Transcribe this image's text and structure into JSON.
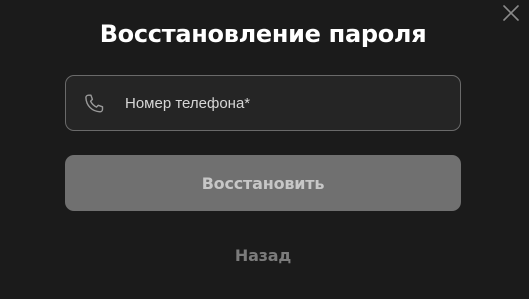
{
  "modal": {
    "title": "Восстановление пароля",
    "close_icon": "close-icon"
  },
  "phone_field": {
    "icon": "phone-icon",
    "placeholder": "Номер телефона*",
    "value": ""
  },
  "submit": {
    "label": "Восстановить"
  },
  "back": {
    "label": "Назад"
  },
  "colors": {
    "background": "#1b1b1b",
    "field_border": "#6a6a6a",
    "button_bg": "#707070",
    "button_text": "#c7c7c7",
    "link_text": "#7b7b7b",
    "title_text": "#ffffff"
  }
}
